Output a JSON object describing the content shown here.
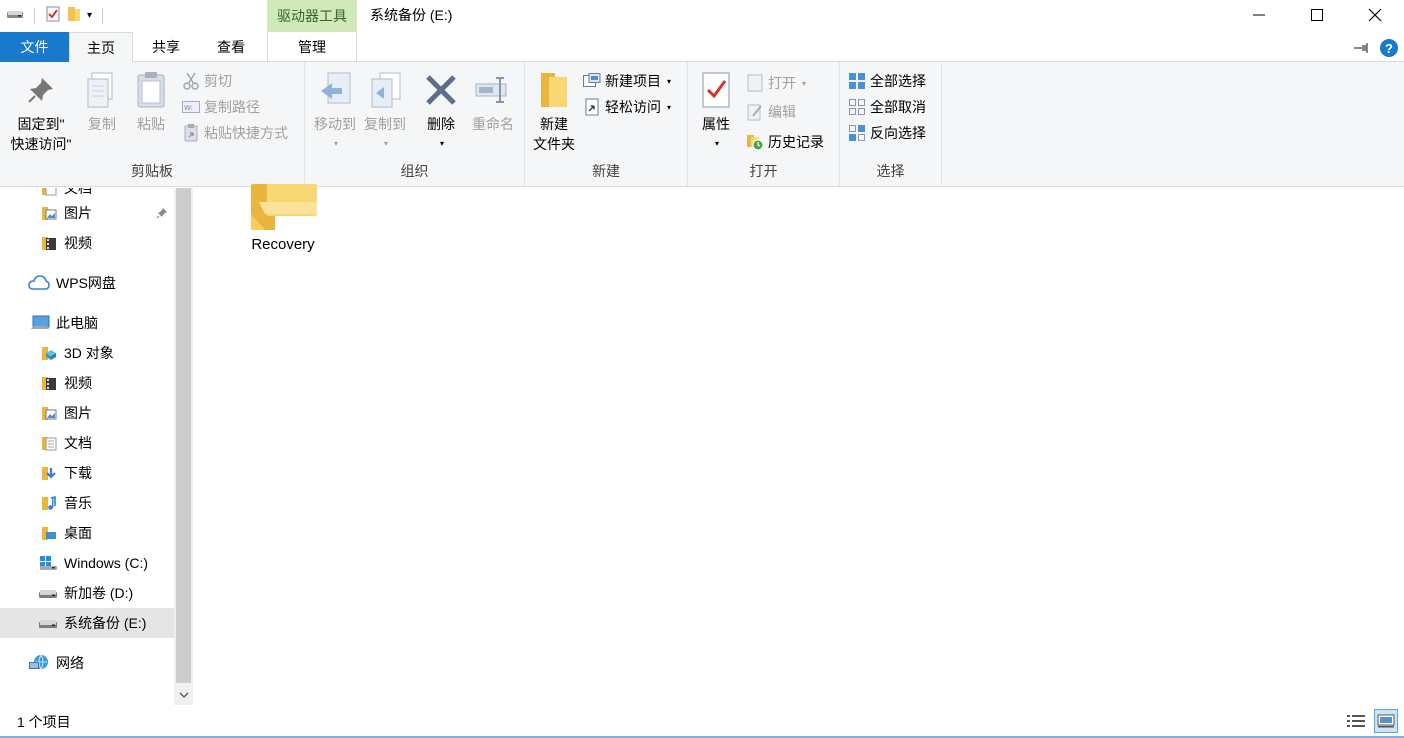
{
  "window": {
    "title": "系统备份 (E:)",
    "context_tab": "驱动器工具"
  },
  "tabs": {
    "file": "文件",
    "home": "主页",
    "share": "共享",
    "view": "查看",
    "manage": "管理"
  },
  "ribbon": {
    "clipboard": {
      "label": "剪贴板",
      "pin": "固定到\"快速访问\"",
      "pin_line1": "固定到\"",
      "pin_line2": "快速访问\"",
      "copy": "复制",
      "paste": "粘贴",
      "cut": "剪切",
      "copy_path": "复制路径",
      "paste_shortcut": "粘贴快捷方式"
    },
    "organize": {
      "label": "组织",
      "move_to": "移动到",
      "copy_to": "复制到",
      "delete": "删除",
      "rename": "重命名"
    },
    "new": {
      "label": "新建",
      "new_folder_line1": "新建",
      "new_folder_line2": "文件夹",
      "new_item": "新建项目",
      "easy_access": "轻松访问"
    },
    "open": {
      "label": "打开",
      "properties": "属性",
      "open": "打开",
      "edit": "编辑",
      "history": "历史记录"
    },
    "select": {
      "label": "选择",
      "select_all": "全部选择",
      "select_none": "全部取消",
      "invert": "反向选择"
    }
  },
  "nav": {
    "items": [
      {
        "label": "文档",
        "icon": "documents-icon"
      },
      {
        "label": "图片",
        "icon": "pictures-icon"
      },
      {
        "label": "视频",
        "icon": "videos-icon"
      },
      {
        "label": "WPS网盘",
        "icon": "cloud-icon"
      },
      {
        "label": "此电脑",
        "icon": "computer-icon"
      },
      {
        "label": "3D 对象",
        "icon": "3d-objects-icon"
      },
      {
        "label": "视频",
        "icon": "videos-icon"
      },
      {
        "label": "图片",
        "icon": "pictures-icon"
      },
      {
        "label": "文档",
        "icon": "documents-icon"
      },
      {
        "label": "下载",
        "icon": "downloads-icon"
      },
      {
        "label": "音乐",
        "icon": "music-icon"
      },
      {
        "label": "桌面",
        "icon": "desktop-icon"
      },
      {
        "label": "Windows (C:)",
        "icon": "windows-drive-icon"
      },
      {
        "label": "新加卷 (D:)",
        "icon": "drive-icon"
      },
      {
        "label": "系统备份 (E:)",
        "icon": "drive-icon"
      },
      {
        "label": "网络",
        "icon": "network-icon"
      }
    ]
  },
  "content": {
    "items": [
      {
        "name": "Recovery",
        "icon": "folder-icon"
      }
    ]
  },
  "status": {
    "count": "1 个项目"
  },
  "colors": {
    "accent": "#1979ca",
    "context_tab_bg": "#d1e9b9",
    "folder": "#f8d775"
  }
}
